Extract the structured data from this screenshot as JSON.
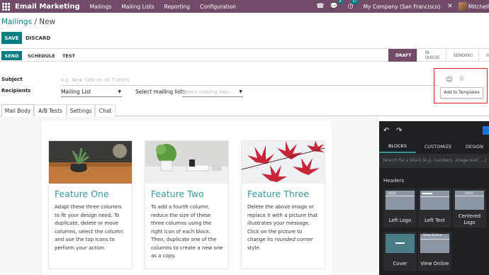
{
  "topbar": {
    "brand": "Email Marketing",
    "menu": [
      "Mailings",
      "Mailing Lists",
      "Reporting",
      "Configuration"
    ],
    "messages_count": "5",
    "activities_count": "37",
    "company": "My Company (San Francisco)",
    "user": "Mitchell",
    "brand_color": "#714B67"
  },
  "breadcrumb": {
    "parent": "Mailings",
    "sep": " / ",
    "current": "New"
  },
  "buttons": {
    "save": "SAVE",
    "discard": "DISCARD"
  },
  "statusbar": {
    "send": "SEND",
    "schedule": "SCHEDULE",
    "test": "TEST",
    "stages": [
      "DRAFT",
      "IN QUEUE",
      "SENDING",
      "SE"
    ],
    "active_stage": "DRAFT"
  },
  "form": {
    "subject_label": "Subject",
    "subject_placeholder": "e.g. New Sale on all T-shirts",
    "recipients_label": "Recipients",
    "recipients_value": "Mailing List",
    "mailing_lists_label": "Select mailing lists:",
    "mailing_lists_placeholder": "Select mailing lists...",
    "tooltip": "Add to Templates"
  },
  "tabs": [
    "Mail Body",
    "A/B Tests",
    "Settings",
    "Chat"
  ],
  "cards": [
    {
      "title": "Feature One",
      "text": "Adapt these three columns to fit your design need. To duplicate, delete or move columns, select the column and use the top icons to perform your action."
    },
    {
      "title": "Feature Two",
      "text": "To add a fourth column, reduce the size of these three columns using the right icon of each block. Then, duplicate one of the columns to create a new one as a copy."
    },
    {
      "title": "Feature Three",
      "text_before": "Delete the above image or replace it with a picture that illustrates your message. Click on the picture to change its ",
      "text_em": "rounded corner",
      "text_after": " style."
    }
  ],
  "panel": {
    "tabs": [
      "BLOCKS",
      "CUSTOMIZE",
      "DESIGN"
    ],
    "search_placeholder": "Search for a block (e.g. numbers, image wall, ...)",
    "section": "Headers",
    "snippets": [
      "Left Logo",
      "Left Text",
      "Centered Logo",
      "Cover",
      "View Online"
    ],
    "thumb_logo": "LOGO",
    "thumb_view_online": "View Online"
  }
}
